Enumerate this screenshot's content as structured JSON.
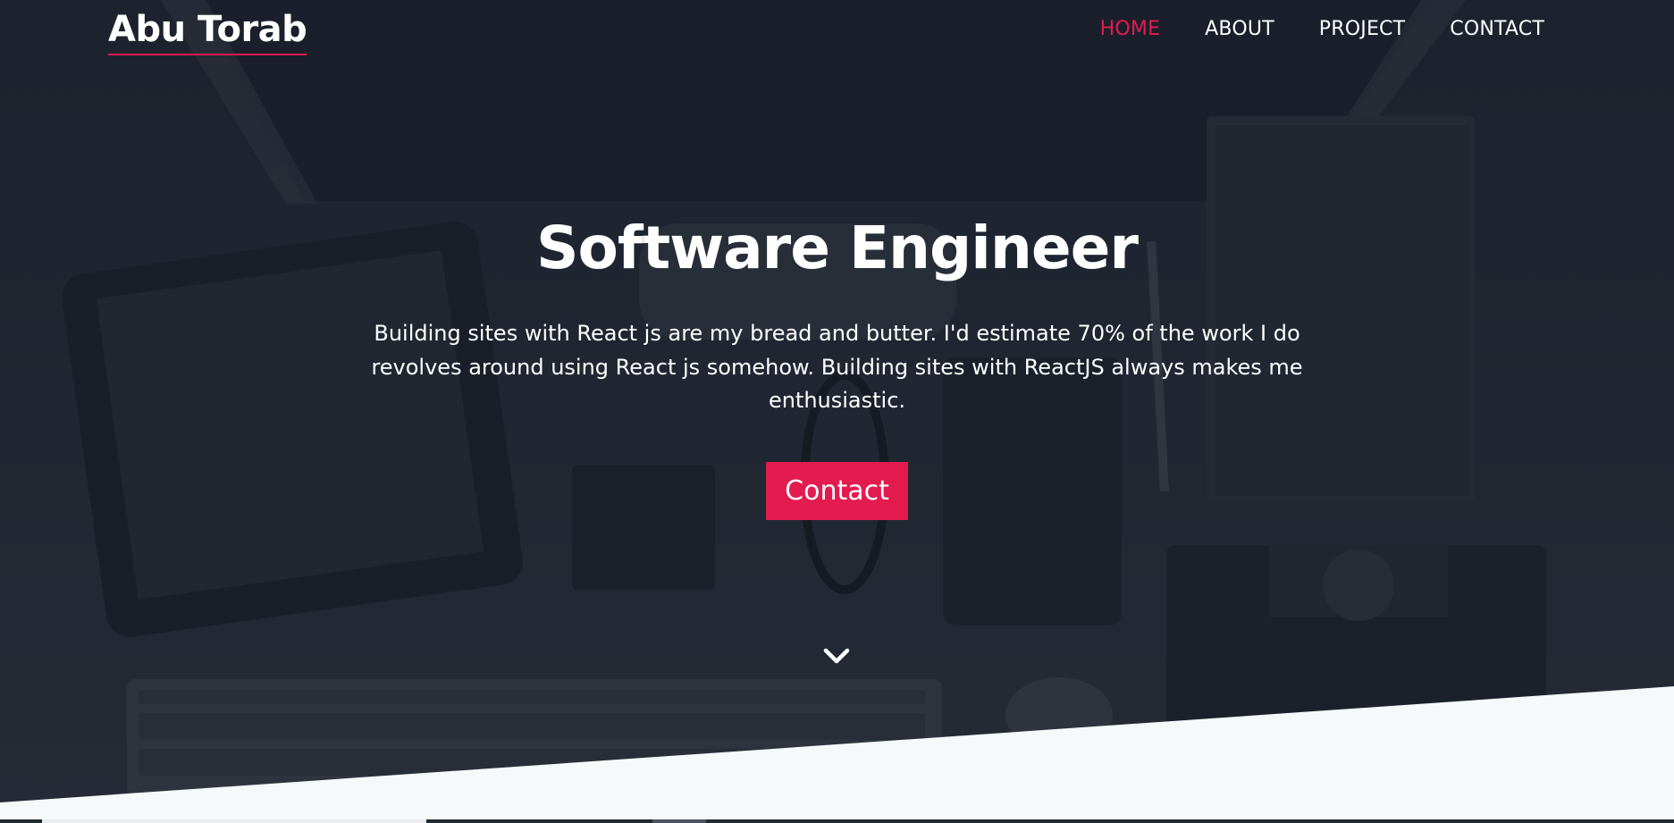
{
  "brand": {
    "name": "Abu Torab",
    "accent_color": "#e31b4f"
  },
  "nav": {
    "items": [
      {
        "label": "HOME",
        "active": true
      },
      {
        "label": "ABOUT",
        "active": false
      },
      {
        "label": "PROJECT",
        "active": false
      },
      {
        "label": "CONTACT",
        "active": false
      }
    ]
  },
  "hero": {
    "title": "Software Engineer",
    "description": "Building sites with React js are my bread and butter. I'd estimate 70% of the work I do revolves around using React js somehow. Building sites with ReactJS always makes me enthusiastic.",
    "cta_label": "Contact",
    "scroll_icon": "chevron-down-icon",
    "background_color": "#242a36"
  },
  "page": {
    "background_color": "#f7f8fa"
  }
}
